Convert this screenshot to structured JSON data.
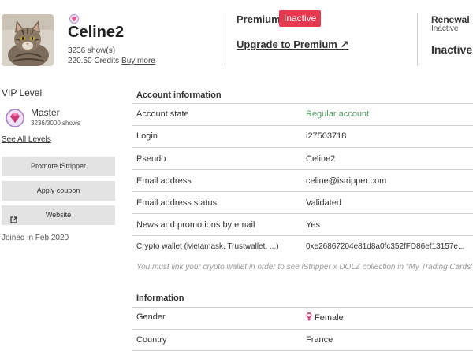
{
  "profile": {
    "username": "Celine2",
    "shows": "3236 show(s)",
    "credits": "220.50 Credits",
    "buy_more": "Buy more",
    "avatar_icon": "cat-photo"
  },
  "premium": {
    "label": "Premium",
    "status": "Inactive",
    "upgrade_link": "Upgrade to Premium ↗"
  },
  "renewal": {
    "label": "Renewal",
    "sublabel": "Inactive",
    "value": "Inactive"
  },
  "vip": {
    "title": "VIP Level",
    "level": "Master",
    "progress": "3236/3000 shows",
    "see_all": "See All Levels",
    "badge_icon": "diamond-badge-icon"
  },
  "sidebar_buttons": {
    "promote": "Promote iStripper",
    "coupon": "Apply coupon",
    "website": "Website"
  },
  "joined": "Joined in Feb 2020",
  "account": {
    "title": "Account information",
    "rows": [
      {
        "label": "Account state",
        "value": "Regular account"
      },
      {
        "label": "Login",
        "value": "i27503718"
      },
      {
        "label": "Pseudo",
        "value": "Celine2"
      },
      {
        "label": "Email address",
        "value": "celine@istripper.com"
      },
      {
        "label": "Email address status",
        "value": "Validated"
      },
      {
        "label": "News and promotions by email",
        "value": "Yes"
      },
      {
        "label": "Crypto wallet (Metamask, Trustwallet, ...)",
        "value": "0xe26867204e81d8a0fc352fFD86ef13157e..."
      }
    ],
    "crypto_note": "You must link your crypto wallet in order to see iStripper x DOLZ collection in \"My Trading Cards\""
  },
  "information": {
    "title": "Information",
    "rows": [
      {
        "label": "Gender",
        "value": "Female"
      },
      {
        "label": "Country",
        "value": "France"
      }
    ]
  },
  "colors": {
    "accent_red": "#e53950",
    "regular_green": "#4f9a62",
    "button_gray": "#e3e3e3"
  }
}
